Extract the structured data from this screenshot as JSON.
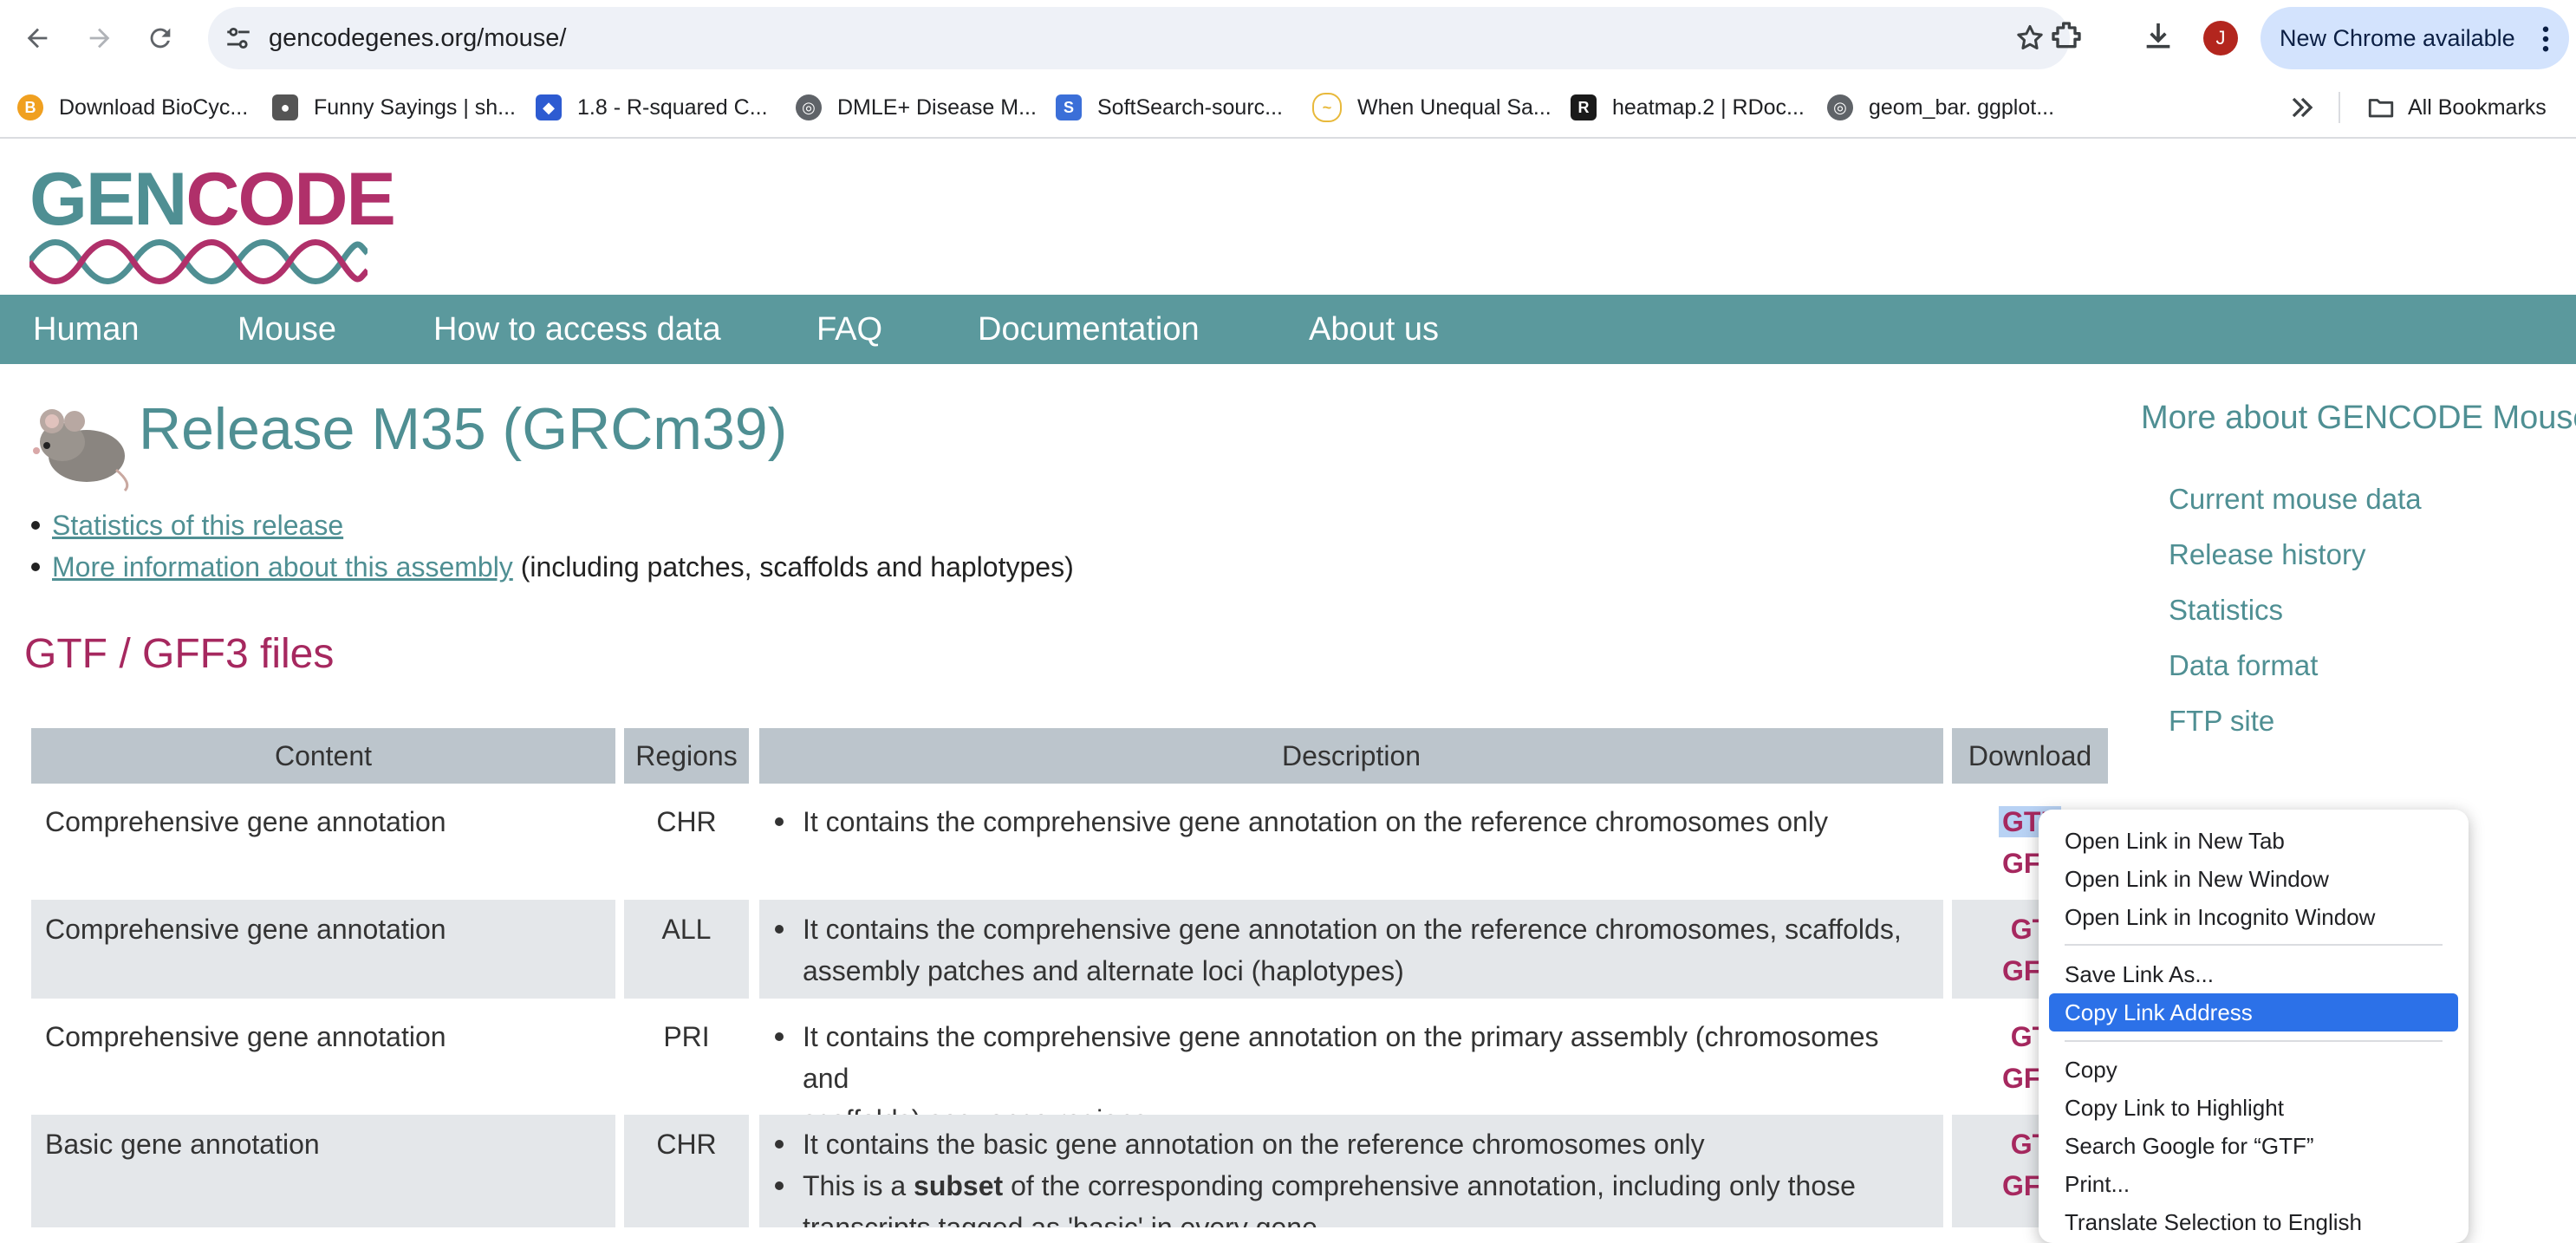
{
  "browser": {
    "url": "gencodegenes.org/mouse/",
    "update_label": "New Chrome available",
    "avatar_letter": "J",
    "bookmarks": [
      {
        "label": "Download BioCyc...",
        "favicon": "biocyc-icon",
        "color": "#f0a020"
      },
      {
        "label": "Funny Sayings | sh...",
        "favicon": "cow-icon",
        "color": "#555555"
      },
      {
        "label": "1.8 - R-squared C...",
        "favicon": "shield-icon",
        "color": "#2d5bd1"
      },
      {
        "label": "DMLE+ Disease M...",
        "favicon": "globe-icon",
        "color": "#5f6368"
      },
      {
        "label": "SoftSearch-sourc...",
        "favicon": "softsearch-icon",
        "color": "#3b6fd8"
      },
      {
        "label": "When Unequal Sa...",
        "favicon": "chart-icon",
        "color": "#e8b93b"
      },
      {
        "label": "heatmap.2 | RDoc...",
        "favicon": "r-icon",
        "color": "#1a1a1a"
      },
      {
        "label": "geom_bar. ggplot...",
        "favicon": "globe-icon",
        "color": "#5f6368"
      }
    ],
    "all_bookmarks": "All Bookmarks"
  },
  "site": {
    "logo_gen": "GEN",
    "logo_code": "CODE",
    "nav": [
      "Human",
      "Mouse",
      "How to access data",
      "FAQ",
      "Documentation",
      "About us"
    ],
    "release_title": "Release M35 (GRCm39)",
    "links": {
      "stats": "Statistics of this release",
      "assembly": "More information about this assembly",
      "assembly_suffix": " (including patches, scaffolds and haplotypes)"
    },
    "section_title": "GTF / GFF3 files",
    "table": {
      "headers": [
        "Content",
        "Regions",
        "Description",
        "Download"
      ],
      "rows": [
        {
          "content": "Comprehensive gene annotation",
          "region": "CHR",
          "desc1": "It contains the comprehensive gene annotation on the reference chromosomes only",
          "desc2": "",
          "dl1": "GTF",
          "dl2": "GFF"
        },
        {
          "content": "Comprehensive gene annotation",
          "region": "ALL",
          "desc1": "It contains the comprehensive gene annotation on the reference chromosomes, scaffolds,",
          "desc2": "assembly patches and alternate loci (haplotypes)",
          "dl1": "GT",
          "dl2": "GFF"
        },
        {
          "content": "Comprehensive gene annotation",
          "region": "PRI",
          "desc1": "It contains the comprehensive gene annotation on the primary assembly (chromosomes and",
          "desc2": "scaffolds) sequence regions",
          "dl1": "GT",
          "dl2": "GFF"
        },
        {
          "content": "Basic gene annotation",
          "region": "CHR",
          "desc1": "It contains the basic gene annotation on the reference chromosomes only",
          "desc2a": "This is a ",
          "desc2b": "subset",
          "desc2c": " of the corresponding comprehensive annotation, including only those",
          "desc3": "transcripts tagged as 'basic' in every gene",
          "dl1": "GT",
          "dl2": "GFF"
        }
      ]
    },
    "sidebar": {
      "title": "More about GENCODE Mouse",
      "links": [
        "Current mouse data",
        "Release history",
        "Statistics",
        "Data format",
        "FTP site"
      ]
    }
  },
  "context_menu": {
    "items": [
      "Open Link in New Tab",
      "Open Link in New Window",
      "Open Link in Incognito Window",
      "Save Link As...",
      "Copy Link Address",
      "Copy",
      "Copy Link to Highlight",
      "Search Google for “GTF”",
      "Print...",
      "Translate Selection to English"
    ],
    "selected": "Copy Link Address"
  },
  "colors": {
    "teal": "#4f8f93",
    "nav_bg": "#5b999d",
    "magenta": "#a6285f",
    "menu_highlight": "#2c71e8"
  }
}
